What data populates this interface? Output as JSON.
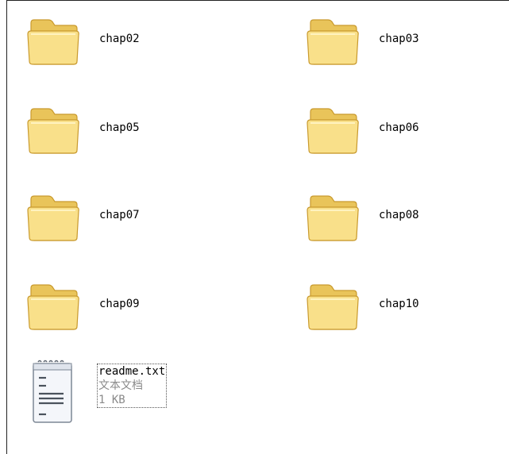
{
  "folders": [
    {
      "name": "chap02"
    },
    {
      "name": "chap03"
    },
    {
      "name": "chap05"
    },
    {
      "name": "chap06"
    },
    {
      "name": "chap07"
    },
    {
      "name": "chap08"
    },
    {
      "name": "chap09"
    },
    {
      "name": "chap10"
    }
  ],
  "file": {
    "name": "readme.txt",
    "type": "文本文档",
    "size": "1 KB",
    "icon": "text-document-icon"
  },
  "colors": {
    "folder_fill": "#f7dc7a",
    "folder_edge": "#c99a2e",
    "background": "#ffffff",
    "secondary_text": "#8a8a8a"
  }
}
